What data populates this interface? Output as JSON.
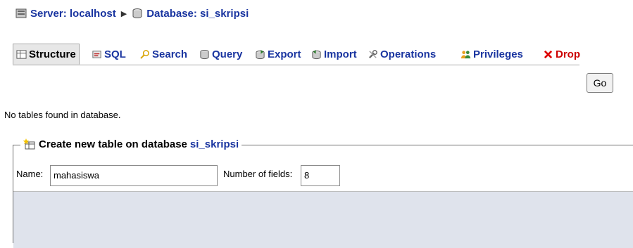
{
  "breadcrumb": {
    "server_label": "Server: localhost",
    "database_label": "Database: si_skripsi"
  },
  "tabs": [
    {
      "label": "Structure",
      "icon": "structure-icon"
    },
    {
      "label": "SQL",
      "icon": "sql-icon"
    },
    {
      "label": "Search",
      "icon": "search-icon"
    },
    {
      "label": "Query",
      "icon": "query-icon"
    },
    {
      "label": "Export",
      "icon": "export-icon"
    },
    {
      "label": "Import",
      "icon": "import-icon"
    },
    {
      "label": "Operations",
      "icon": "operations-icon"
    },
    {
      "label": "Privileges",
      "icon": "privileges-icon"
    },
    {
      "label": "Drop",
      "icon": "drop-icon"
    }
  ],
  "message": "No tables found in database.",
  "create_table": {
    "legend_text": "Create new table on database",
    "database_name": "si_skripsi",
    "name_label": "Name:",
    "name_value": "mahasiswa",
    "fields_label": "Number of fields:",
    "fields_value": "8",
    "go_label": "Go"
  },
  "colors": {
    "link": "#1a35a0",
    "drop": "#cc0000",
    "bar": "#dfe3ec"
  }
}
